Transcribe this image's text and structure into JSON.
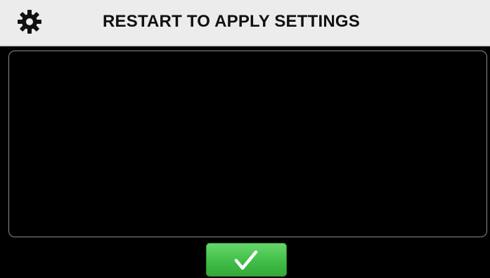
{
  "header": {
    "title": "RESTART TO APPLY SETTINGS",
    "icon": "gear-icon"
  },
  "message_panel": {
    "text": ""
  },
  "confirm_button": {
    "icon": "checkmark-icon",
    "color": "#41be47"
  },
  "colors": {
    "header_bg": "#ececec",
    "screen_bg": "#000000",
    "panel_border": "#8a8a8a",
    "accent_green": "#41be47"
  }
}
